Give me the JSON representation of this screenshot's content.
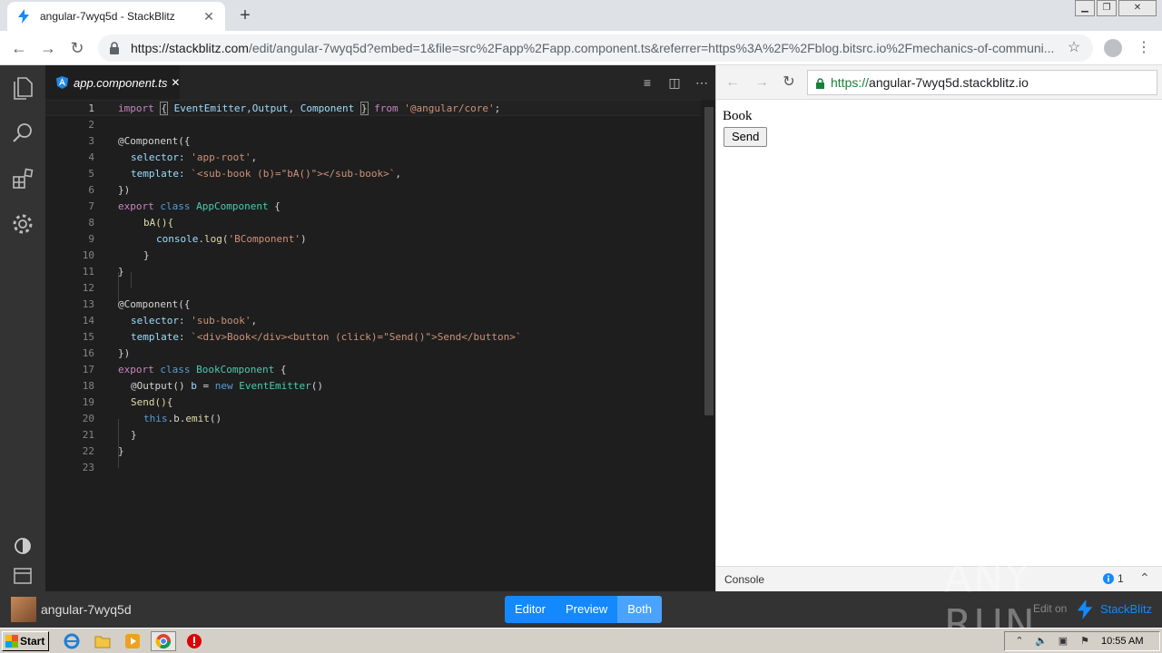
{
  "browser": {
    "tab_title": "angular-7wyq5d - StackBlitz",
    "url_host": "https://stackblitz.com",
    "url_rest": "/edit/angular-7wyq5d?embed=1&file=src%2Fapp%2Fapp.component.ts&referrer=https%3A%2F%2Fblog.bitsrc.io%2Fmechanics-of-communi..."
  },
  "editor": {
    "file_tab": "app.component.ts",
    "active_line": 1,
    "lines": [
      {
        "n": "1"
      },
      {
        "n": "2"
      },
      {
        "n": "3"
      },
      {
        "n": "4"
      },
      {
        "n": "5"
      },
      {
        "n": "6"
      },
      {
        "n": "7"
      },
      {
        "n": "8"
      },
      {
        "n": "9"
      },
      {
        "n": "10"
      },
      {
        "n": "11"
      },
      {
        "n": "12"
      },
      {
        "n": "13"
      },
      {
        "n": "14"
      },
      {
        "n": "15"
      },
      {
        "n": "16"
      },
      {
        "n": "17"
      },
      {
        "n": "18"
      },
      {
        "n": "19"
      },
      {
        "n": "20"
      },
      {
        "n": "21"
      },
      {
        "n": "22"
      },
      {
        "n": "23"
      }
    ],
    "code": {
      "l1_import": "import",
      "l1_brace_open": "{",
      "l1_names": " EventEmitter,Output, Component ",
      "l1_brace_close": "}",
      "l1_from": "from",
      "l1_mod": "'@angular/core'",
      "l1_semi": ";",
      "l3": "@Component({",
      "l4_key": "selector:",
      "l4_val": "'app-root'",
      "l4_end": ",",
      "l5_key": "template:",
      "l5_val": "`<sub-book (b)=\"bA()\"></sub-book>`",
      "l5_end": ",",
      "l6": "})",
      "l7_export": "export",
      "l7_class": "class",
      "l7_name": "AppComponent",
      "l7_brace": "{",
      "l8": "bA(){",
      "l9_obj": "console",
      "l9_dot": ".",
      "l9_fn": "log",
      "l9_open": "(",
      "l9_str": "'BComponent'",
      "l9_close": ")",
      "l10": "}",
      "l11": "}",
      "l13": "@Component({",
      "l14_key": "selector:",
      "l14_val": "'sub-book'",
      "l14_end": ",",
      "l15_key": "template:",
      "l15_val": "`<div>Book</div><button (click)=\"Send()\">Send</button>`",
      "l16": "})",
      "l17_export": "export",
      "l17_class": "class",
      "l17_name": "BookComponent",
      "l17_brace": "{",
      "l18_dec": "@Output() ",
      "l18_var": "b",
      "l18_eq": " = ",
      "l18_new": "new",
      "l18_type": "EventEmitter",
      "l18_paren": "()",
      "l19": "Send(){",
      "l20_this": "this",
      "l20_rest": ".b.",
      "l20_fn": "emit",
      "l20_paren": "()",
      "l21": "}",
      "l22": "}"
    }
  },
  "preview": {
    "url_scheme": "https://",
    "url_host": "angular-7wyq5d.stackblitz.io",
    "book_text": "Book",
    "send_button": "Send",
    "console_label": "Console",
    "console_count": "1"
  },
  "bottom_bar": {
    "project_name": "angular-7wyq5d",
    "view_editor": "Editor",
    "view_preview": "Preview",
    "view_both": "Both",
    "active_view": "Both",
    "edit_on": "Edit on",
    "brand": "StackBlitz",
    "accent": "#1389fd"
  },
  "watermark": "ANY RUN",
  "taskbar": {
    "start_label": "Start",
    "clock": "10:55 AM"
  }
}
